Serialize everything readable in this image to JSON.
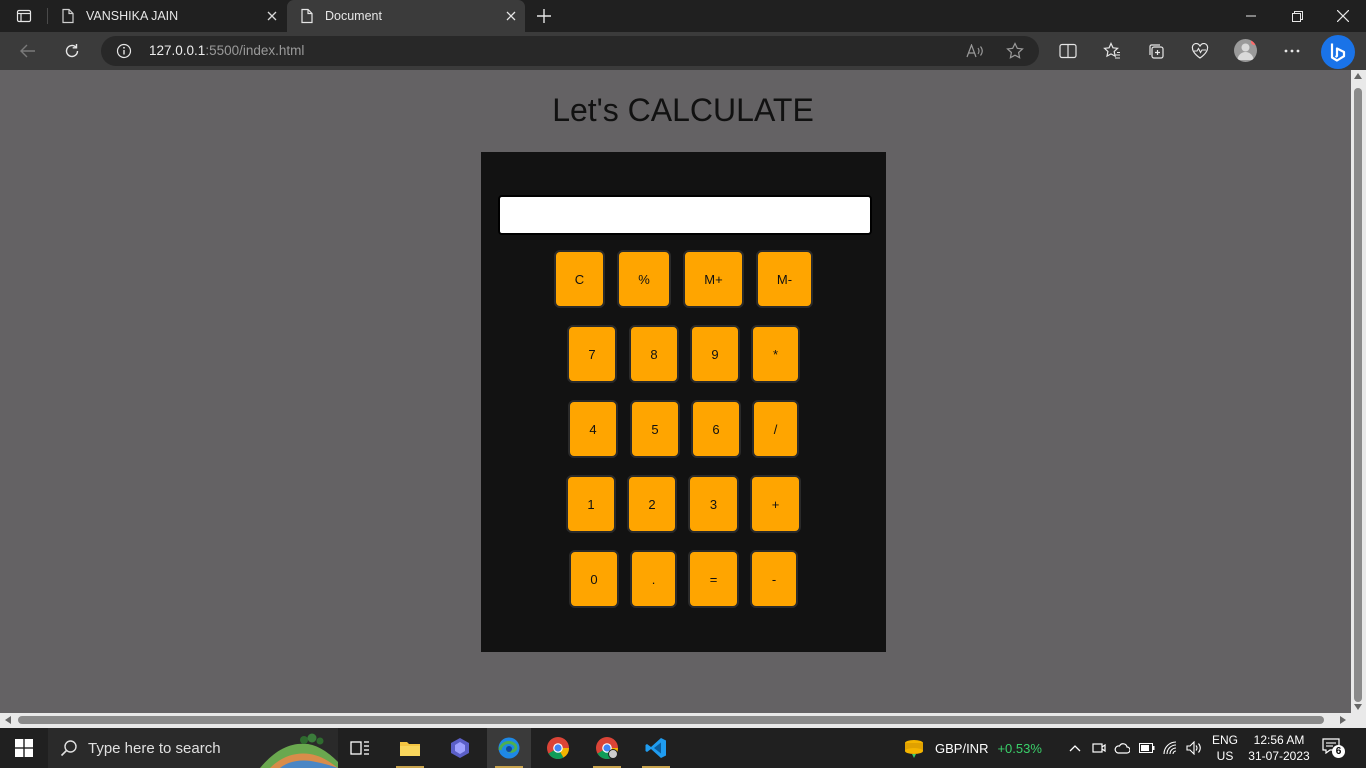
{
  "browser": {
    "tabs": [
      {
        "title": "VANSHIKA JAIN",
        "active": false
      },
      {
        "title": "Document",
        "active": true
      }
    ],
    "address": {
      "host": "127.0.0.1",
      "path": ":5500/index.html"
    }
  },
  "page": {
    "title": "Let's CALCULATE",
    "display_value": "",
    "accent_color": "#ffa500",
    "keys": {
      "clear": "C",
      "percent": "%",
      "mem_plus": "M+",
      "mem_minus": "M-",
      "seven": "7",
      "eight": "8",
      "nine": "9",
      "multiply": "*",
      "four": "4",
      "five": "5",
      "six": "6",
      "divide": "/",
      "one": "1",
      "two": "2",
      "three": "3",
      "add": "+",
      "zero": "0",
      "decimal": ".",
      "equals": "=",
      "subtract": "-"
    }
  },
  "taskbar": {
    "search_placeholder": "Type here to search",
    "ticker": {
      "pair": "GBP/INR",
      "change": "+0.53%"
    },
    "language": {
      "line1": "ENG",
      "line2": "US"
    },
    "clock": {
      "time": "12:56 AM",
      "date": "31-07-2023"
    },
    "notifications": "6"
  }
}
